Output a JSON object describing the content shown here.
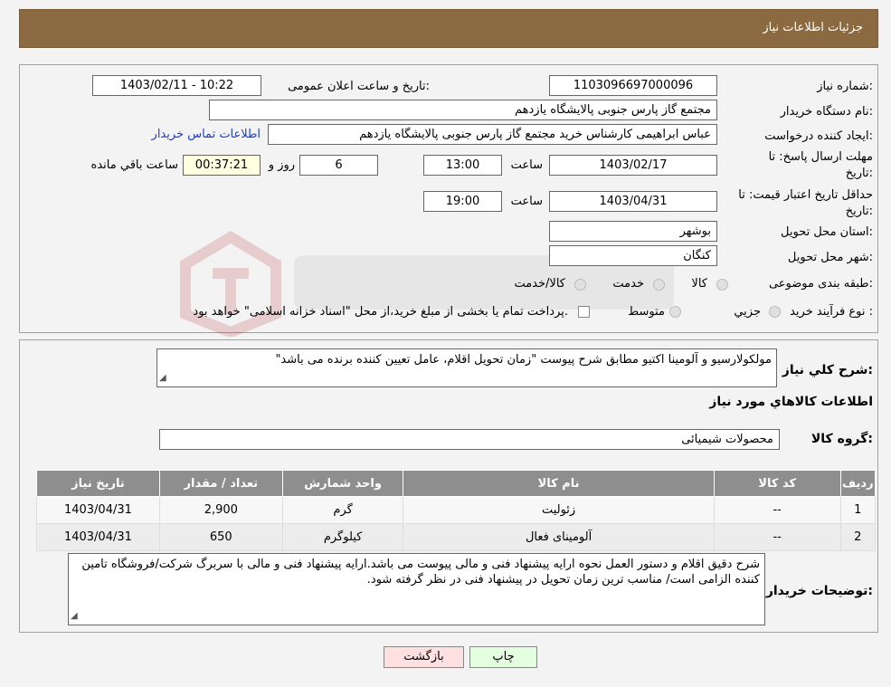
{
  "header": {
    "title": "جزئیات اطلاعات نیاز"
  },
  "form": {
    "need_number_label": "شماره نیاز:",
    "need_number": "1103096697000096",
    "announce_label": "تاریخ و ساعت اعلان عمومی:",
    "announce_value": "1403/02/11 - 10:22",
    "buyer_org_label": "نام دستگاه خریدار:",
    "buyer_org": "مجتمع گاز پارس جنوبی  پالایشگاه یازدهم",
    "creator_label": "ایجاد کننده درخواست:",
    "creator": "عباس ابراهیمی کارشناس خرید مجتمع گاز پارس جنوبی  پالایشگاه یازدهم",
    "contact_link": "اطلاعات تماس خریدار",
    "reply_deadline_label_1": "مهلت ارسال پاسخ: تا",
    "reply_deadline_label_2": "تاریخ:",
    "reply_date": "1403/02/17",
    "time_label": "ساعت",
    "reply_time": "13:00",
    "days_value": "6",
    "days_label": "روز و",
    "remaining_value": "00:37:21",
    "remaining_label": "ساعت باقي مانده",
    "price_validity_label_1": "حداقل تاریخ اعتبار قیمت: تا",
    "price_validity_label_2": "تاریخ:",
    "price_date": "1403/04/31",
    "price_time": "19:00",
    "province_label": "استان محل تحویل:",
    "province": "بوشهر",
    "city_label": "شهر محل تحویل:",
    "city": "کنگان",
    "category_label": "طبقه بندی موضوعی:",
    "category_options": [
      "کالا",
      "خدمت",
      "کالا/خدمت"
    ],
    "process_label": "نوع فرآیند خرید :",
    "process_options": [
      "جزیي",
      "متوسط"
    ],
    "process_note": "پرداخت تمام یا بخشی از مبلغ خرید،از محل \"اسناد خزانه اسلامی\" خواهد بود."
  },
  "details": {
    "description_label": "شرح كلي نياز:",
    "description": "مولکولارسیو و آلومینا اکتیو مطابق شرح پیوست \"زمان تحویل اقلام، عامل تعیین کننده برنده می باشد\"",
    "goods_info_title": "اطلاعات كالاهاي مورد نياز",
    "goods_group_label": "گروه کالا:",
    "goods_group": "محصولات شیمیائی",
    "table": {
      "headers": [
        "رديف",
        "کد کالا",
        "نام کالا",
        "واحد شمارش",
        "تعداد / مقدار",
        "تاریخ نیاز"
      ],
      "rows": [
        [
          "1",
          "--",
          "زئولیت",
          "گرم",
          "2,900",
          "1403/04/31"
        ],
        [
          "2",
          "--",
          "آلومینای فعال",
          "کیلوگرم",
          "650",
          "1403/04/31"
        ]
      ]
    },
    "buyer_notes_label": "توضیحات خریدار:",
    "buyer_notes": "شرح دقیق اقلام و دستور العمل نحوه ارایه پیشنهاد فنی و مالی پیوست می باشد.ارایه پیشنهاد فنی و مالی با سربرگ شرکت/فروشگاه تامین کننده الزامی است/ مناسب ترین زمان تحویل در پیشنهاد فنی در نظر گرفته شود."
  },
  "buttons": {
    "print": "چاپ",
    "back": "بازگشت"
  },
  "colors": {
    "header_bg": "#8b6a42",
    "table_header_bg": "#8e8e8e",
    "link": "#1e3cc8",
    "back_btn_bg": "#ffe0e0",
    "print_btn_bg": "#e4ffe0"
  }
}
